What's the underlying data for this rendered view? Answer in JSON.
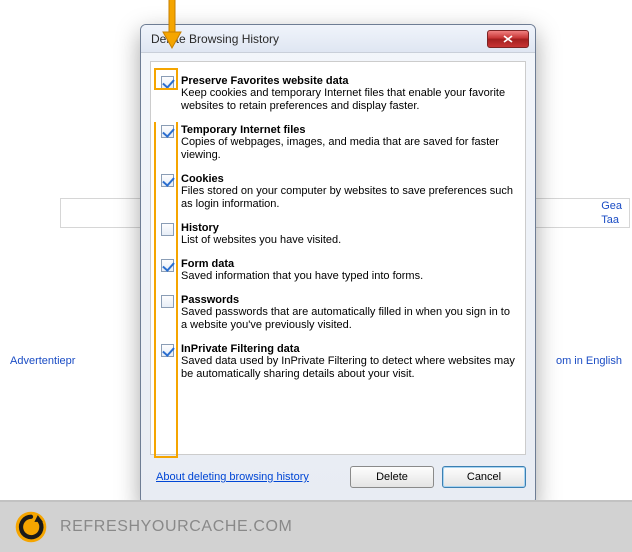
{
  "dialog": {
    "title": "Delete Browsing History",
    "options": [
      {
        "checked": true,
        "title": "Preserve Favorites website data",
        "desc": "Keep cookies and temporary Internet files that enable your favorite websites to retain preferences and display faster."
      },
      {
        "checked": true,
        "title": "Temporary Internet files",
        "desc": "Copies of webpages, images, and media that are saved for faster viewing."
      },
      {
        "checked": true,
        "title": "Cookies",
        "desc": "Files stored on your computer by websites to save preferences such as login information."
      },
      {
        "checked": false,
        "title": "History",
        "desc": "List of websites you have visited."
      },
      {
        "checked": true,
        "title": "Form data",
        "desc": "Saved information that you have typed into forms."
      },
      {
        "checked": false,
        "title": "Passwords",
        "desc": "Saved passwords that are automatically filled in when you sign in to a website you've previously visited."
      },
      {
        "checked": true,
        "title": "InPrivate Filtering data",
        "desc": "Saved data used by InPrivate Filtering to detect where websites may be automatically sharing details about your visit."
      }
    ],
    "help_link": "About deleting browsing history",
    "delete_label": "Delete",
    "cancel_label": "Cancel"
  },
  "background": {
    "right_links": "Gea\nTaa",
    "left_link": "Advertentiepr",
    "right_link2": "om in English"
  },
  "footer": {
    "text": "REFRESHYOURCACHE.COM"
  }
}
